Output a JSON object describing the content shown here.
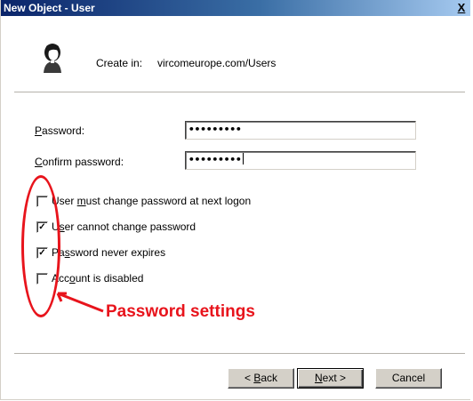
{
  "window": {
    "title": "New Object - User",
    "close_glyph": "X"
  },
  "header": {
    "icon": "user-icon",
    "create_in_label": "Create in:",
    "create_in_value": "vircomeurope.com/Users"
  },
  "fields": {
    "password_label_key": "P",
    "password_label_rest": "assword:",
    "password_value": "•••••••••",
    "confirm_label_key": "C",
    "confirm_label_rest": "onfirm password:",
    "confirm_value": "•••••••••"
  },
  "checkboxes": [
    {
      "pre": "User ",
      "key": "m",
      "post": "ust change password at next logon",
      "checked": false
    },
    {
      "pre": "U",
      "key": "s",
      "post": "er cannot change password",
      "checked": true
    },
    {
      "pre": "Pa",
      "key": "s",
      "post": "sword never expires",
      "checked": true
    },
    {
      "pre": "Acc",
      "key": "o",
      "post": "unt is disabled",
      "checked": false
    }
  ],
  "annotation": {
    "text": "Password settings",
    "color": "#e8141c"
  },
  "buttons": {
    "back_pre": "< ",
    "back_key": "B",
    "back_post": "ack",
    "next_key": "N",
    "next_post": "ext >",
    "cancel": "Cancel"
  },
  "colors": {
    "titlebar_start": "#0a246a",
    "titlebar_end": "#a6caf0",
    "button_face": "#d4d0c8"
  }
}
